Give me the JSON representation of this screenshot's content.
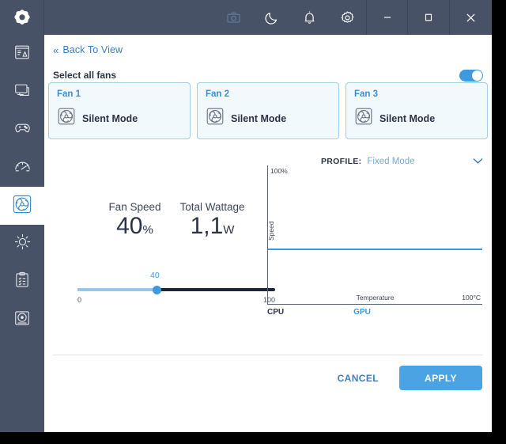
{
  "window": {
    "logo_icon": "brand-diamond-logo",
    "header_icons": [
      {
        "name": "screenshot-icon",
        "label": "Screenshot",
        "active": false
      },
      {
        "name": "moon-icon",
        "label": "Night Mode",
        "active": true
      },
      {
        "name": "bell-icon",
        "label": "Notifications",
        "active": true
      },
      {
        "name": "gear-icon",
        "label": "Settings",
        "active": true
      }
    ],
    "controls": [
      {
        "name": "minimize-button",
        "glyph": "–"
      },
      {
        "name": "maximize-button",
        "glyph": "□"
      },
      {
        "name": "close-button",
        "glyph": "✕"
      }
    ]
  },
  "sidebar": {
    "items": [
      {
        "name": "sidebar-item-system-info",
        "icon": "monitor-report-icon",
        "active": false
      },
      {
        "name": "sidebar-item-display",
        "icon": "desktop-icon",
        "active": false
      },
      {
        "name": "sidebar-item-gaming",
        "icon": "gamepad-icon",
        "active": false
      },
      {
        "name": "sidebar-item-performance",
        "icon": "gauge-icon",
        "active": false
      },
      {
        "name": "sidebar-item-fan-control",
        "icon": "fan-icon",
        "active": true
      },
      {
        "name": "sidebar-item-lighting",
        "icon": "sun-icon",
        "active": false
      },
      {
        "name": "sidebar-item-tasks",
        "icon": "clipboard-icon",
        "active": false
      },
      {
        "name": "sidebar-item-storage",
        "icon": "disc-icon",
        "active": false
      }
    ]
  },
  "page": {
    "back_link": "Back To View",
    "back_chevron": "«",
    "select_all_label": "Select all fans",
    "select_all_enabled": true
  },
  "fans": [
    {
      "title": "Fan 1",
      "mode": "Silent Mode",
      "icon": "fan-icon",
      "selected": true
    },
    {
      "title": "Fan 2",
      "mode": "Silent Mode",
      "icon": "fan-icon",
      "selected": true
    },
    {
      "title": "Fan 3",
      "mode": "Silent Mode",
      "icon": "fan-icon",
      "selected": true
    }
  ],
  "readouts": {
    "fan_speed_label": "Fan Speed",
    "fan_speed_value": "40",
    "fan_speed_unit": "%",
    "wattage_label": "Total Wattage",
    "wattage_value": "1,1",
    "wattage_unit": "W"
  },
  "slider": {
    "value_label": "40",
    "min_label": "0",
    "max_label": "100",
    "value": 40,
    "min": 0,
    "max": 100
  },
  "profile": {
    "label": "PROFILE:",
    "value": "Fixed Mode",
    "chevron": "⌄"
  },
  "footer": {
    "cancel_label": "CANCEL",
    "apply_label": "APPLY"
  },
  "colors": {
    "accent_blue": "#3d9ae0",
    "link_blue": "#3d7fc1",
    "chrome_navy": "#485266",
    "track_dark": "#1b2638",
    "track_fill": "#93c9ec"
  },
  "chart_data": {
    "type": "line",
    "title": "",
    "xlabel": "Temperature",
    "ylabel": "Speed",
    "x": [
      0,
      100
    ],
    "series": [
      {
        "name": "GPU",
        "values": [
          40,
          40
        ],
        "color": "#3d9ae0"
      }
    ],
    "legend": [
      "CPU",
      "GPU"
    ],
    "legend_position": "below",
    "active_legend": "GPU",
    "ylim": [
      0,
      100
    ],
    "xlim": [
      0,
      100
    ],
    "ytick_labels": [
      "100%"
    ],
    "xtick_labels": [
      "100°C"
    ],
    "grid": false
  }
}
